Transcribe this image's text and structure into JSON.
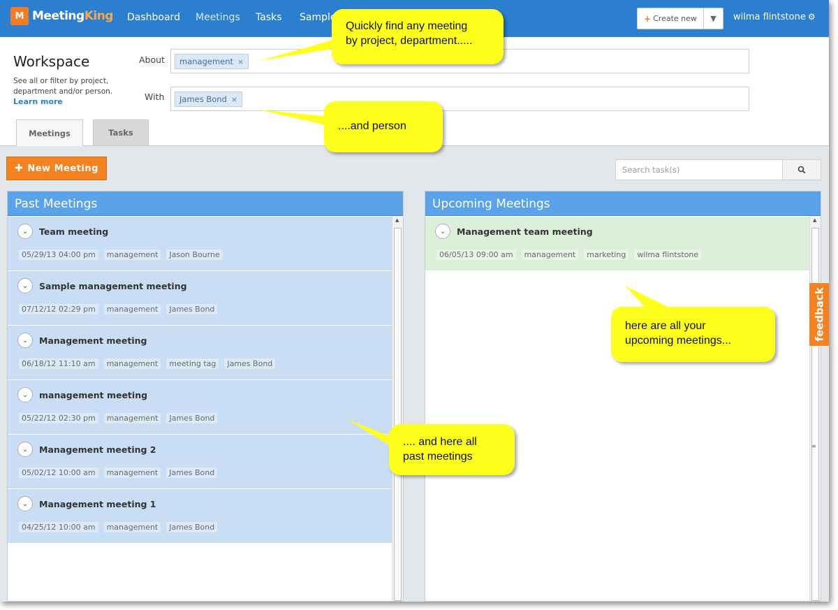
{
  "app": {
    "logo_mark": "M",
    "logo_text_a": "Meeting",
    "logo_text_b": "King"
  },
  "nav": {
    "items": [
      "Dashboard",
      "Meetings",
      "Tasks",
      "Sample"
    ],
    "active": "Meetings",
    "create_label": "Create new",
    "user_name": "wilma flintstone"
  },
  "workspace": {
    "title": "Workspace",
    "description": "See all or filter by project, department and/or person.",
    "learn_more": "Learn more",
    "about_label": "About",
    "about_chip": "management",
    "with_label": "With",
    "with_chip": "James Bond"
  },
  "tabs": [
    "Meetings",
    "Tasks"
  ],
  "toolbar": {
    "new_meeting": "New Meeting",
    "search_placeholder": "Search task(s)"
  },
  "past_meetings": {
    "title": "Past Meetings",
    "items": [
      {
        "title": "Team meeting",
        "tags": [
          "05/29/13 04:00 pm",
          "management",
          "Jason Bourne"
        ]
      },
      {
        "title": "Sample management meeting",
        "tags": [
          "07/12/12 02:29 pm",
          "management",
          "James Bond"
        ]
      },
      {
        "title": "Management meeting",
        "tags": [
          "06/18/12 11:10 am",
          "management",
          "meeting tag",
          "James Bond"
        ]
      },
      {
        "title": "management meeting",
        "tags": [
          "05/22/12 02:30 pm",
          "management",
          "James Bond"
        ]
      },
      {
        "title": "Management meeting 2",
        "tags": [
          "05/02/12 10:00 am",
          "management",
          "James Bond"
        ]
      },
      {
        "title": "Management meeting 1",
        "tags": [
          "04/25/12 10:00 am",
          "management",
          "James Bond"
        ]
      }
    ]
  },
  "upcoming_meetings": {
    "title": "Upcoming Meetings",
    "items": [
      {
        "title": "Management team meeting",
        "tags": [
          "06/05/13 09:00 am",
          "management",
          "marketing",
          "wilma flintstone"
        ]
      }
    ]
  },
  "feedback_label": "feedback",
  "callouts": {
    "find": [
      "Quickly find any meeting",
      "by project, department....."
    ],
    "person": [
      "....and person"
    ],
    "upcoming": [
      "here are all your",
      "upcoming meetings..."
    ],
    "past": [
      ".... and here all",
      "past meetings"
    ]
  },
  "colors": {
    "nav_bg": "#2b7fce",
    "accent_orange": "#f58220",
    "panel_header": "#5aa2e9",
    "past_row": "#c9def5",
    "upcoming_row": "#dcefd9",
    "callout_yellow": "#ffff1e"
  },
  "icons": {
    "gear": "gear-icon",
    "search": "search-icon",
    "chevron": "chevron-down-icon",
    "plus": "plus-icon",
    "remove": "close-icon"
  }
}
